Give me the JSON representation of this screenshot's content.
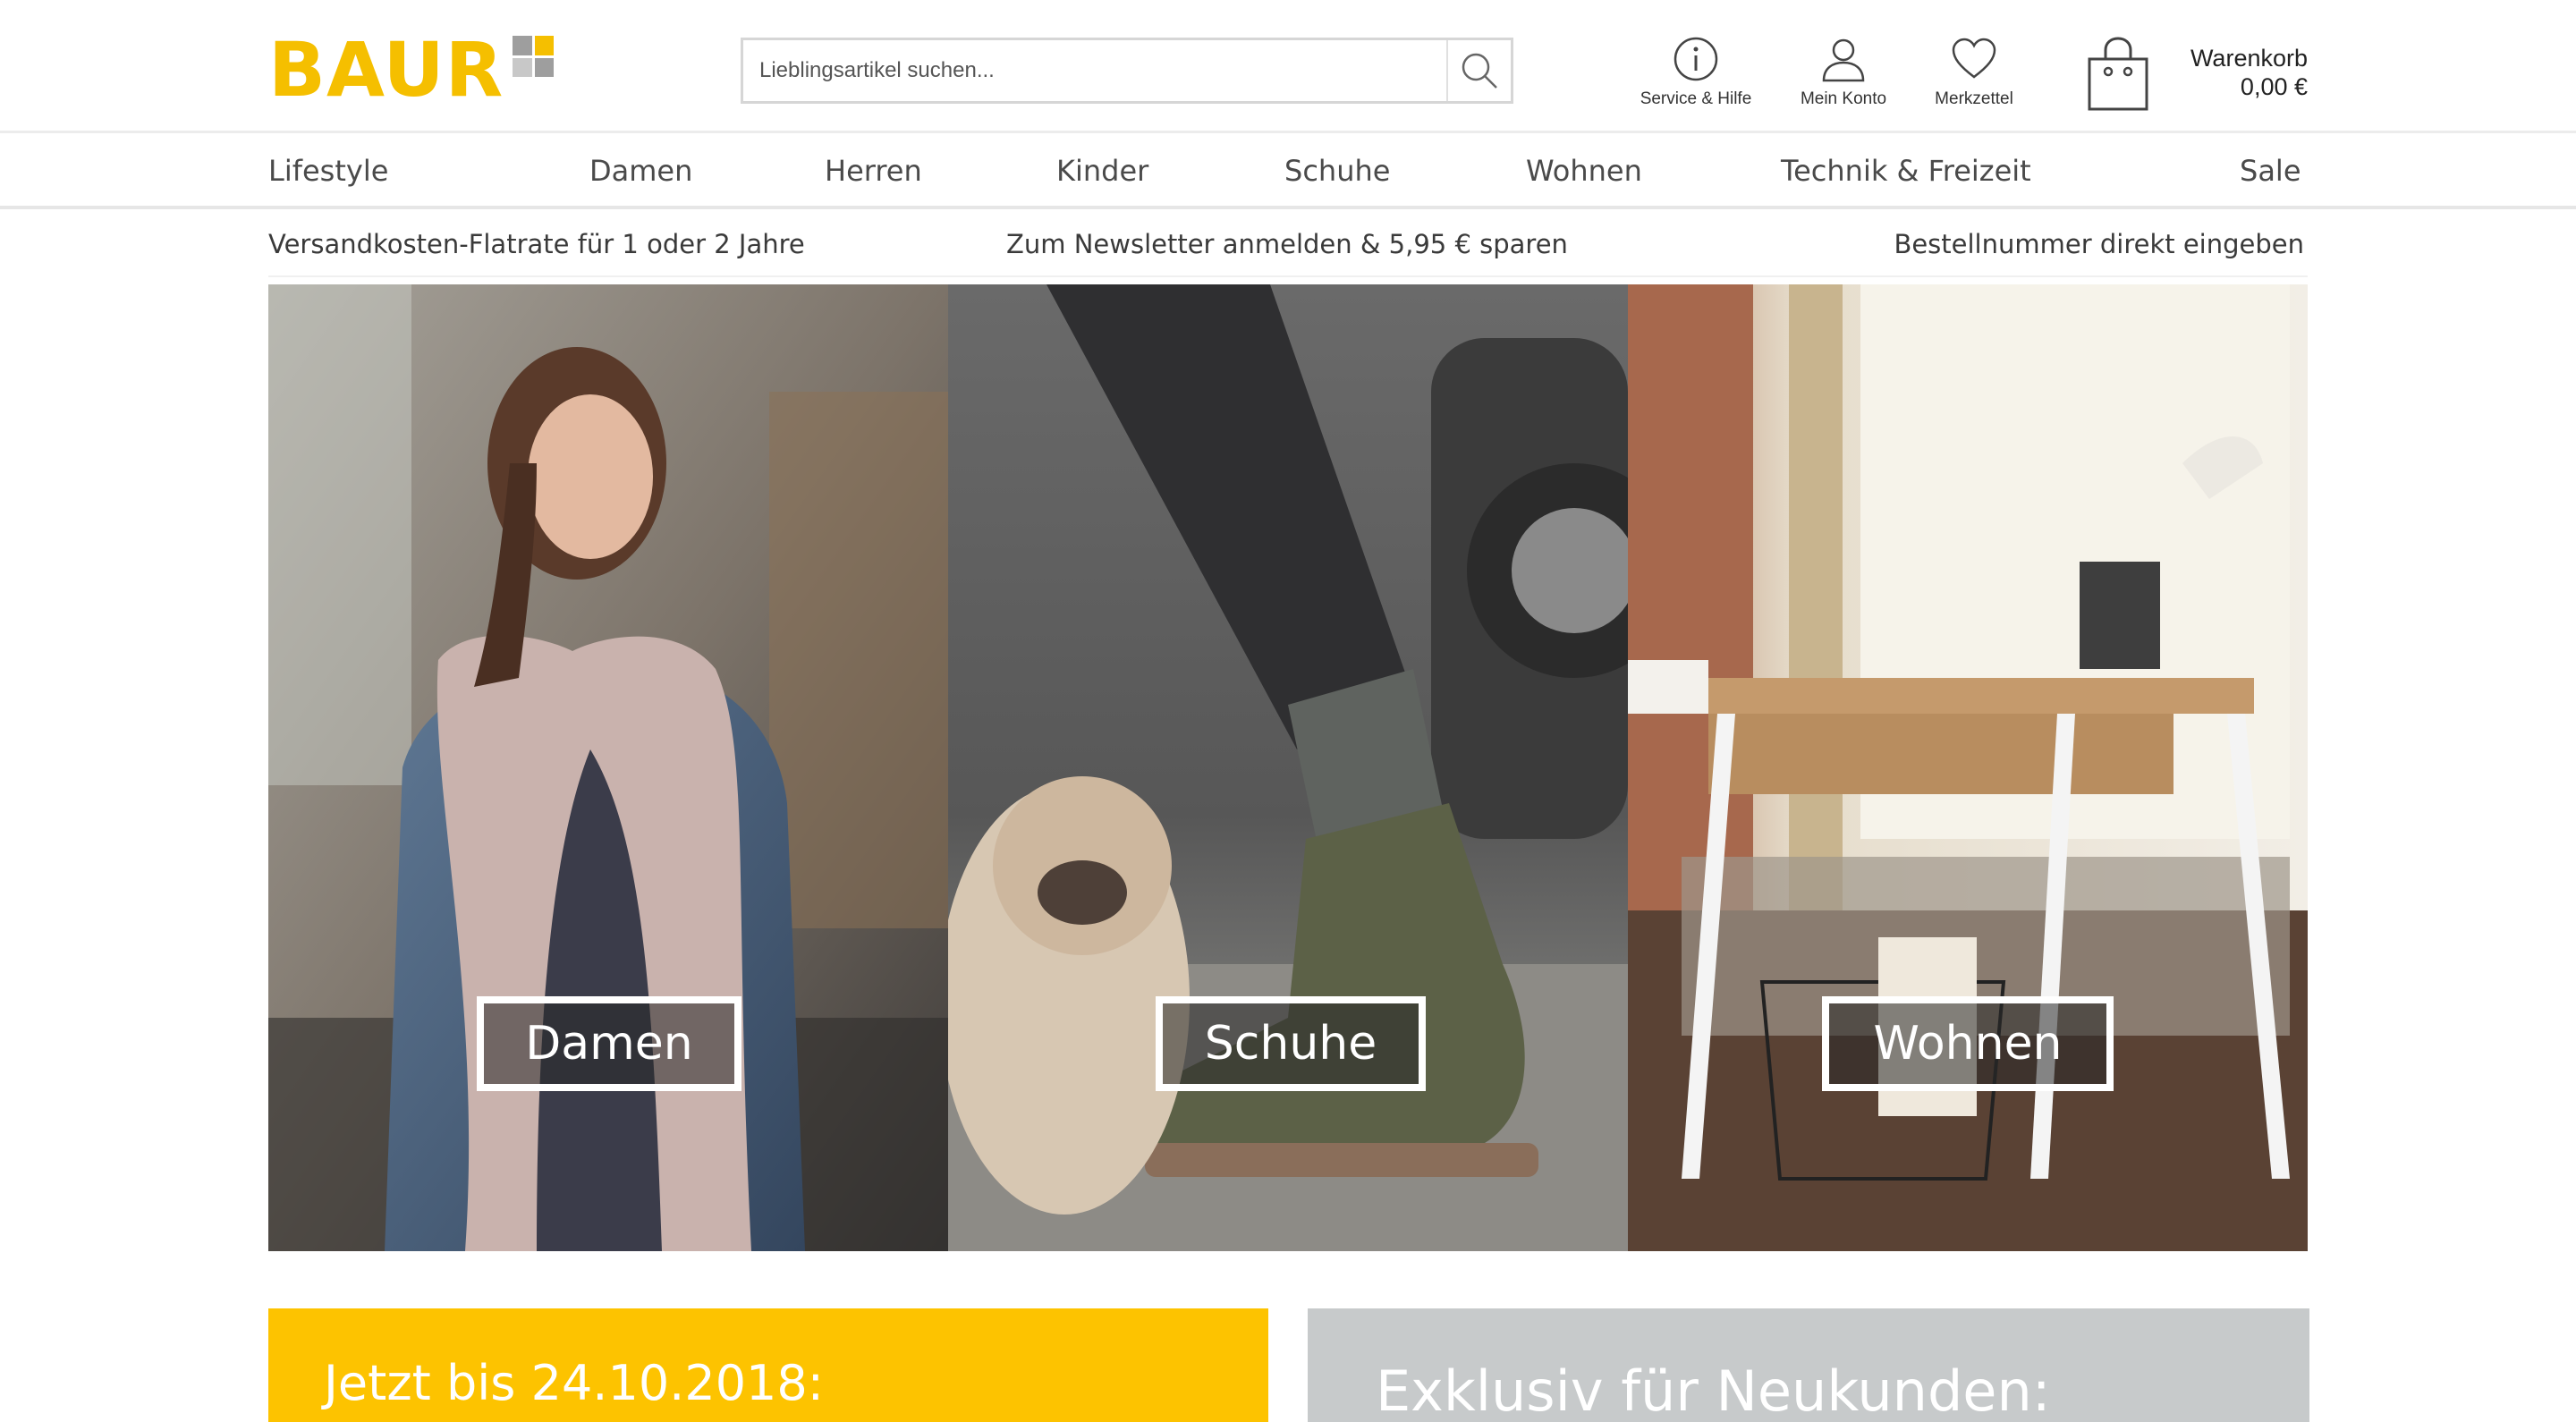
{
  "brand": {
    "logo_text": "BAUR",
    "accent": "#f5bf00"
  },
  "search": {
    "placeholder": "Lieblingsartikel suchen...",
    "icon": "search-icon"
  },
  "utility": {
    "service_label": "Service & Hilfe",
    "konto_label": "Mein Konto",
    "merkzettel_label": "Merkzettel"
  },
  "cart": {
    "title": "Warenkorb",
    "total": "0,00 €",
    "icon": "shopping-bag-icon"
  },
  "nav": {
    "items": [
      "Lifestyle",
      "Damen",
      "Herren",
      "Kinder",
      "Schuhe",
      "Wohnen",
      "Technik & Freizeit",
      "Sale"
    ]
  },
  "infobar": {
    "left": "Versandkosten-Flatrate für 1 oder 2 Jahre",
    "center": "Zum Newsletter anmelden & 5,95 € sparen",
    "right": "Bestellnummer direkt eingeben"
  },
  "tiles": [
    {
      "label": "Damen"
    },
    {
      "label": "Schuhe"
    },
    {
      "label": "Wohnen"
    }
  ],
  "promos": {
    "left_text": "Jetzt bis 24.10.2018:",
    "left_color": "#fdc300",
    "right_text": "Exklusiv für Neukunden:",
    "right_color": "#c7cacb"
  }
}
